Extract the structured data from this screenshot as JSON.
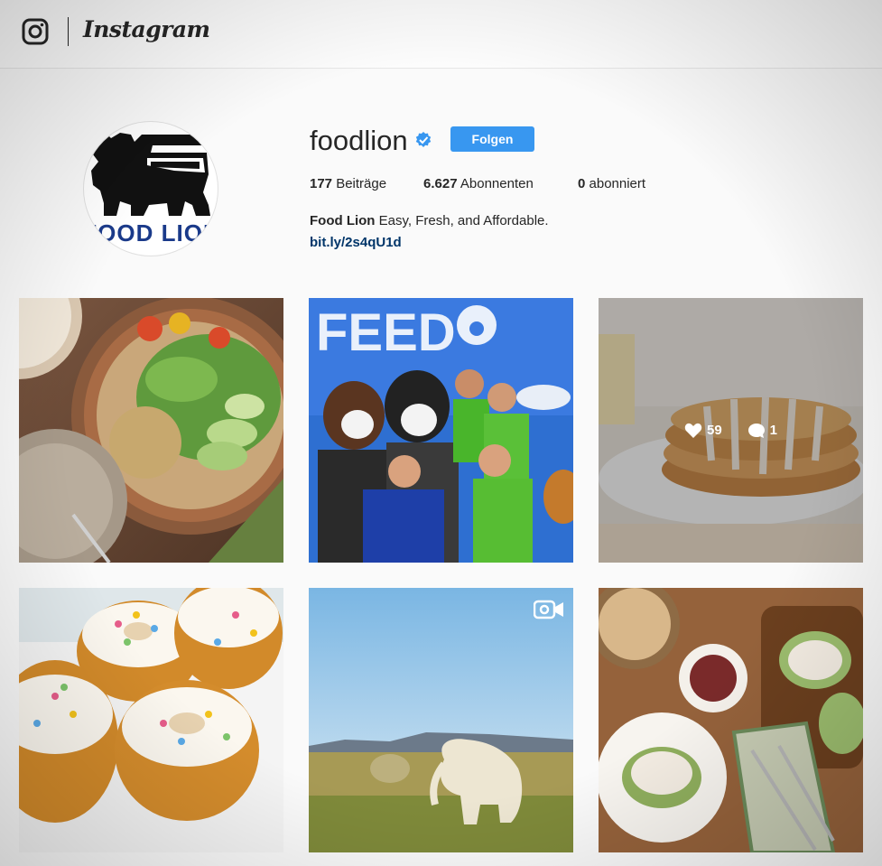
{
  "app": {
    "name": "Instagram"
  },
  "profile": {
    "username": "foodlion",
    "verified": true,
    "follow_label": "Folgen",
    "avatar_text": "FOOD LION",
    "stats": [
      {
        "count": "177",
        "label": "Beiträge"
      },
      {
        "count": "6.627",
        "label": "Abonnenten"
      },
      {
        "count": "0",
        "label": "abonniert"
      }
    ],
    "bio_name": "Food Lion",
    "bio_text": "Easy, Fresh, and Affordable.",
    "bio_link": "bit.ly/2s4qU1d"
  },
  "posts": [
    {
      "kind": "salad-bowl"
    },
    {
      "kind": "feed-event",
      "sign_text": "FEED"
    },
    {
      "kind": "pancakes",
      "likes": "59",
      "comments": "1"
    },
    {
      "kind": "bundt-cakes"
    },
    {
      "kind": "elephant-field",
      "is_video": true
    },
    {
      "kind": "chicken-dishes"
    }
  ],
  "colors": {
    "accent": "#3897f0",
    "link": "#003569",
    "text": "#262626"
  }
}
